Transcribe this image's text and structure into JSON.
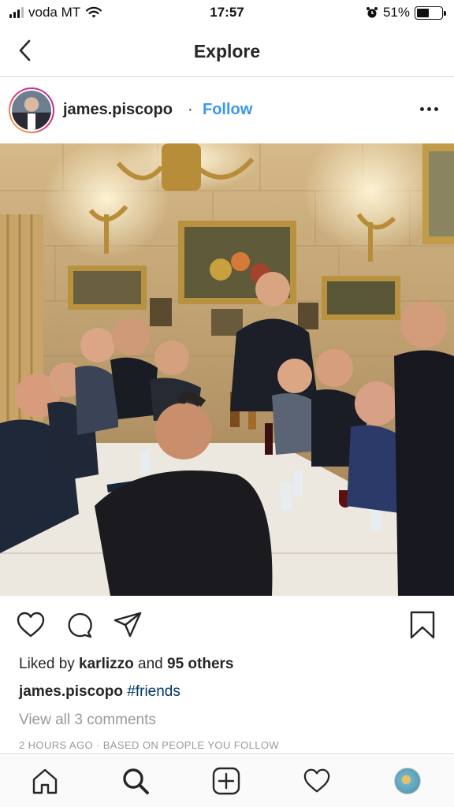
{
  "status_bar": {
    "carrier": "voda MT",
    "time": "17:57",
    "battery_percent": "51%",
    "battery_level": 0.51
  },
  "nav": {
    "title": "Explore",
    "back_icon": "chevron-left-icon"
  },
  "post": {
    "username": "james.piscopo",
    "separator": "·",
    "follow_label": "Follow",
    "more_icon": "more-horizontal-icon",
    "likes_prefix": "Liked by ",
    "likes_user": "karlizzo",
    "likes_middle": " and ",
    "likes_others": "95 others",
    "caption_user": "james.piscopo",
    "caption_hashtag": "#friends",
    "view_comments": "View all 3 comments",
    "timestamp": "2 HOURS AGO · BASED ON PEOPLE YOU FOLLOW"
  },
  "actions": {
    "like_icon": "heart-icon",
    "comment_icon": "comment-icon",
    "share_icon": "paper-plane-icon",
    "save_icon": "bookmark-icon"
  },
  "tab_bar": {
    "items": [
      "home-icon",
      "search-icon",
      "add-post-icon",
      "activity-heart-icon",
      "profile-avatar"
    ]
  },
  "colors": {
    "accent": "#3897f0",
    "hashtag": "#003569",
    "muted": "#999999",
    "text": "#262626",
    "divider": "#dbdbdb"
  }
}
